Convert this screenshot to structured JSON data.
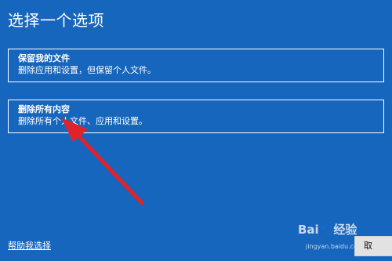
{
  "page": {
    "title": "选择一个选项"
  },
  "options": [
    {
      "title": "保留我的文件",
      "description": "删除应用和设置，但保留个人文件。"
    },
    {
      "title": "删除所有内容",
      "description": "删除所有个人文件、应用和设置。"
    }
  ],
  "footer": {
    "help_label": "帮助我选择",
    "cancel_label": "取"
  },
  "watermark": {
    "brand": "Bai🐾经验",
    "url": "jingyan.baidu.com"
  },
  "colors": {
    "background": "#1766bd",
    "text": "#ffffff",
    "arrow": "#e0232b"
  }
}
